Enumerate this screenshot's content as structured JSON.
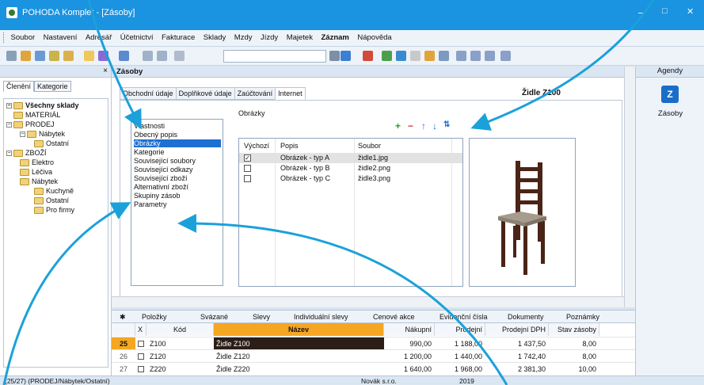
{
  "window": {
    "title": "POHODA Komplet - [Zásoby]",
    "minimize": "–",
    "maximize": "□",
    "close": "✕"
  },
  "menu": [
    "Soubor",
    "Nastavení",
    "Adresář",
    "Účetnictví",
    "Fakturace",
    "Sklady",
    "Mzdy",
    "Jízdy",
    "Majetek",
    "Záznam",
    "Nápověda"
  ],
  "left_panel": {
    "close": "×",
    "tabs": [
      "Členění",
      "Kategorie"
    ],
    "tree": [
      "Všechny sklady",
      "MATERIÁL",
      "PRODEJ",
      "Nábytek",
      "Ostatní",
      "ZBOŽÍ",
      "Elektro",
      "Léčiva",
      "Nábytek",
      "Kuchyně",
      "Ostatní",
      "Pro firmy"
    ]
  },
  "main": {
    "header": "Zásoby",
    "tabs": [
      "Obchodní údaje",
      "Doplňkové údaje",
      "Zaúčtování",
      "Internet"
    ],
    "record_name": "Židle Z100",
    "properties": [
      "Vlastnosti",
      "Obecný popis",
      "Obrázky",
      "Kategorie",
      "Související soubory",
      "Související odkazy",
      "Související zboží",
      "Alternativní zboží",
      "Skupiny zásob",
      "Parametry"
    ],
    "images_label": "Obrázky",
    "image_table": {
      "columns": [
        "Výchozí",
        "Popis",
        "Soubor"
      ],
      "rows": [
        {
          "default": true,
          "popis": "Obrázek - typ A",
          "soubor": "židle1.jpg"
        },
        {
          "default": false,
          "popis": "Obrázek - typ B",
          "soubor": "židle2.png"
        },
        {
          "default": false,
          "popis": "Obrázek - typ C",
          "soubor": "židle3.png"
        }
      ]
    }
  },
  "agendy": {
    "header": "Agendy",
    "item": "Zásoby"
  },
  "subtabs": [
    "Položky",
    "Svázané",
    "Slevy",
    "Individuální slevy",
    "Cenové akce",
    "Evidenční čísla",
    "Dokumenty",
    "Poznámky"
  ],
  "grid": {
    "columns": [
      "X",
      "Kód",
      "Název",
      "Nákupní",
      "Prodejní",
      "Prodejní DPH",
      "Stav zásoby"
    ],
    "rows": [
      {
        "n": "25",
        "kod": "Z100",
        "nazev": "Židle Z100",
        "nakupni": "990,00",
        "prodejni": "1 188,00",
        "dph": "1 437,50",
        "stav": "8,00"
      },
      {
        "n": "26",
        "kod": "Z120",
        "nazev": "Židle Z120",
        "nakupni": "1 200,00",
        "prodejni": "1 440,00",
        "dph": "1 742,40",
        "stav": "8,00"
      },
      {
        "n": "27",
        "kod": "Z220",
        "nazev": "Židle Z220",
        "nakupni": "1 640,00",
        "prodejni": "1 968,00",
        "dph": "2 381,30",
        "stav": "10,00"
      }
    ]
  },
  "status": {
    "path": "(25/27) (PRODEJ/Nábytek/Ostatní)",
    "company": "Novák s.r.o.",
    "year": "2019"
  },
  "colors": {
    "titlebar": "#1a93e0",
    "arrow": "#1ba1d9",
    "selection": "#1d6fd1",
    "name_header": "#f5a623"
  }
}
